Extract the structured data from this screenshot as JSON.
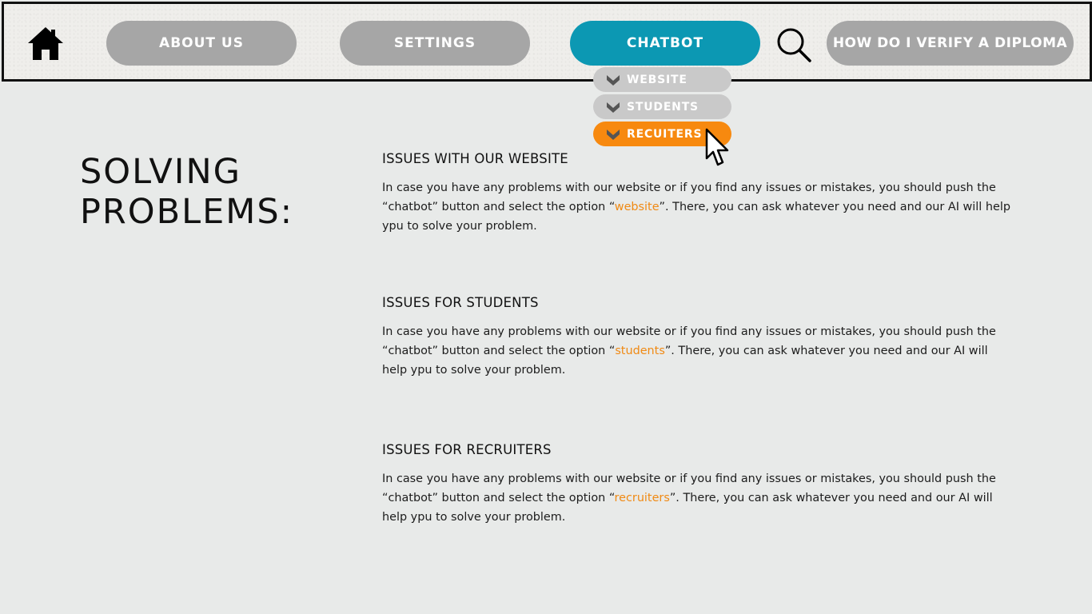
{
  "nav": {
    "home_icon": "home-icon",
    "about_label": "ABOUT US",
    "settings_label": "SETTINGS",
    "chatbot_label": "CHATBOT",
    "search_icon": "search-icon",
    "verify_label": "HOW DO I VERIFY A DIPLOMA",
    "colors": {
      "inactive": "#a6a6a6",
      "active": "#0c98b3"
    }
  },
  "dropdown": {
    "items": [
      {
        "label": "WEBSITE",
        "icon": "chevron-down-icon"
      },
      {
        "label": "STUDENTS",
        "icon": "chevron-down-icon"
      },
      {
        "label": "RECUITERS",
        "icon": "chevron-down-icon"
      }
    ],
    "highlight_color": "#f7890f"
  },
  "main": {
    "title_line1": "SOLVING",
    "title_line2": "PROBLEMS:",
    "sections": [
      {
        "heading": "ISSUES WITH OUR WEBSITE",
        "text_before": "In case you have any problems with our website or if you find any issues or mistakes, you should push the “chatbot” button and select the option “",
        "highlight": "website",
        "text_after": "”. There, you can ask whatever you need and our AI will help ypu to solve your problem."
      },
      {
        "heading": "ISSUES FOR STUDENTS",
        "text_before": "In case you have any problems with our website or if you find any issues or mistakes, you should push the “chatbot” button and select the option “",
        "highlight": "students",
        "text_after": "”. There, you can ask whatever you need and our AI will help ypu to solve your problem."
      },
      {
        "heading": "ISSUES FOR RECRUITERS",
        "text_before": "In case you have any problems with our website or if you find any issues or mistakes, you should push the “chatbot” button and select the option “",
        "highlight": "recruiters",
        "text_after": "”. There, you can ask whatever you need and our AI will help ypu to solve your problem."
      }
    ],
    "accent_color": "#f08a14"
  }
}
